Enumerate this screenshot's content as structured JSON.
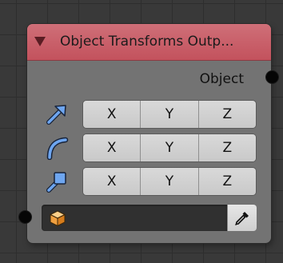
{
  "node": {
    "title": "Object Transforms Outp...",
    "header_color": "#c95a65",
    "output_label": "Object",
    "rows": [
      {
        "icon": "location-arrow-icon",
        "x": "X",
        "y": "Y",
        "z": "Z"
      },
      {
        "icon": "rotation-arc-icon",
        "x": "X",
        "y": "Y",
        "z": "Z"
      },
      {
        "icon": "scale-arrow-icon",
        "x": "X",
        "y": "Y",
        "z": "Z"
      }
    ],
    "object_field": {
      "value": "",
      "icon": "object-cube-icon"
    },
    "picker_icon": "eyedropper-icon"
  }
}
